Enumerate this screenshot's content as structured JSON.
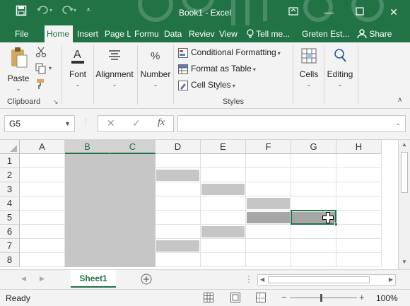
{
  "window": {
    "title": "Book1 - Excel",
    "minimize_icon": "minimize-icon",
    "restore_icon": "restore-down-icon",
    "close_icon": "close-icon",
    "ribbon_display_icon": "ribbon-display-options-icon"
  },
  "quick_access": {
    "save_icon": "save-icon",
    "undo_icon": "undo-icon",
    "redo_icon": "redo-icon",
    "customize_icon": "customize-qat-icon"
  },
  "tabs": [
    {
      "label": "File"
    },
    {
      "label": "Home"
    },
    {
      "label": "Insert"
    },
    {
      "label": "Page L"
    },
    {
      "label": "Formu"
    },
    {
      "label": "Data"
    },
    {
      "label": "Reviev"
    },
    {
      "label": "View"
    }
  ],
  "active_tab": "Home",
  "tell_me": "Tell me...",
  "account": "Greten Est...",
  "share": "Share",
  "ribbon": {
    "clipboard": {
      "paste": "Paste",
      "group_label": "Clipboard"
    },
    "font": {
      "label": "Font"
    },
    "alignment": {
      "label": "Alignment"
    },
    "number": {
      "label": "Number"
    },
    "styles": {
      "conditional_formatting": "Conditional Formatting",
      "format_as_table": "Format as Table",
      "cell_styles": "Cell Styles",
      "group_label": "Styles"
    },
    "cells": {
      "label": "Cells"
    },
    "editing": {
      "label": "Editing"
    }
  },
  "formula_bar": {
    "name_box": "G5",
    "function_icon": "fx",
    "value": ""
  },
  "grid": {
    "columns": [
      "A",
      "B",
      "C",
      "D",
      "E",
      "F",
      "G",
      "H"
    ],
    "rows": [
      "1",
      "2",
      "3",
      "4",
      "5",
      "6",
      "7",
      "8"
    ],
    "selected_columns": [
      "B",
      "C"
    ],
    "active_cell": "G5",
    "shaded_cells": [
      "D2",
      "E3",
      "F4",
      "F5",
      "G5",
      "E6",
      "D7"
    ],
    "fill_colors": {
      "column_fill": "#c6c6c6",
      "cell_fill": "#c6c6c6",
      "dark_fill": "#a6a6a6",
      "active_border": "#217346"
    }
  },
  "sheets": [
    {
      "name": "Sheet1",
      "active": true
    }
  ],
  "status": {
    "ready": "Ready",
    "zoom": "100%"
  },
  "colors": {
    "accent": "#217346",
    "ribbon_bg": "#f3f3f3"
  }
}
